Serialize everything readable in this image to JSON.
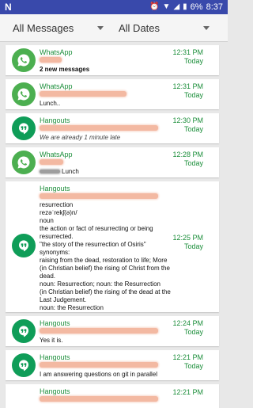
{
  "status_bar": {
    "app_icon": "N",
    "battery": "6%",
    "clock": "8:37",
    "icons": [
      "alarm-icon",
      "wifi-icon",
      "signal-icon",
      "battery-icon"
    ]
  },
  "filters": {
    "messages_filter": "All Messages",
    "dates_filter": "All Dates"
  },
  "colors": {
    "status_bar_bg": "#3949ab",
    "whatsapp_green": "#4caf50",
    "hangouts_green": "#0f9d58",
    "accent_text": "#1b8e3a"
  },
  "notifications": [
    {
      "app": "WhatsApp",
      "message": "2 new messages",
      "time": "12:31 PM",
      "date": "Today"
    },
    {
      "app": "WhatsApp",
      "message": "Lunch..",
      "time": "12:31 PM",
      "date": "Today"
    },
    {
      "app": "Hangouts",
      "message": "We are already 1 minute late",
      "time": "12:30 PM",
      "date": "Today"
    },
    {
      "app": "WhatsApp",
      "message": "Lunch",
      "time": "12:28 PM",
      "date": "Today"
    },
    {
      "app": "Hangouts",
      "message": "resurrection\nrezəˈrekʃ(ə)n/\nnoun\nthe action or fact of resurrecting or being resurrected.\n\"the story of the resurrection of Osiris\"\nsynonyms:\nraising from the dead, restoration to life; More\n(in Christian belief) the rising of Christ from the dead.\nnoun: Resurrection; noun: the Resurrection\n(in Christian belief) the rising of the dead at the Last Judgement.\nnoun: the Resurrection",
      "time": "12:25 PM",
      "date": "Today"
    },
    {
      "app": "Hangouts",
      "message": "Yes it is.",
      "time": "12:24 PM",
      "date": "Today"
    },
    {
      "app": "Hangouts",
      "message": "I am answering questions on git in parallel",
      "time": "12:21 PM",
      "date": "Today"
    },
    {
      "app": "Hangouts",
      "message": "",
      "time": "12:21 PM",
      "date": ""
    }
  ]
}
